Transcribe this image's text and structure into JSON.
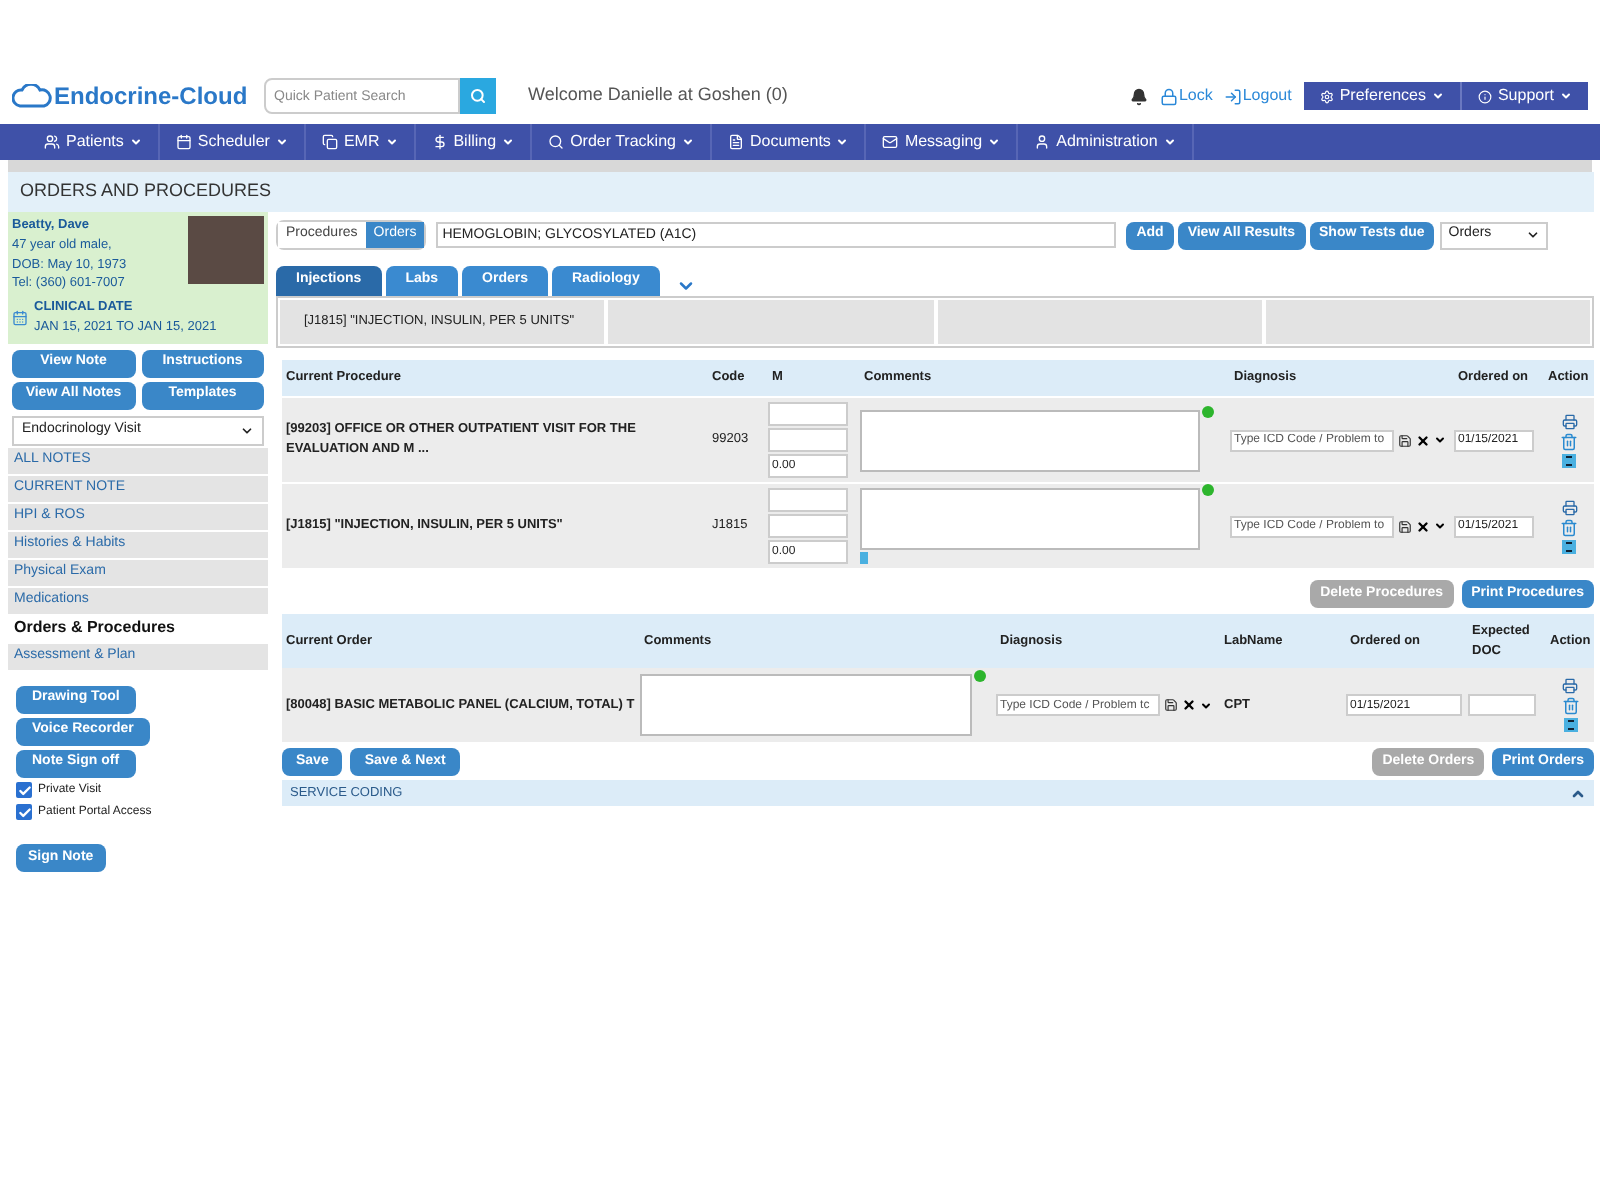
{
  "header": {
    "logo": "Endocrine-Cloud",
    "search_placeholder": "Quick Patient Search",
    "welcome": "Welcome Danielle at Goshen (0)",
    "lock": "Lock",
    "logout": "Logout",
    "menus": [
      "Preferences",
      "Support"
    ]
  },
  "nav": [
    "Patients",
    "Scheduler",
    "EMR",
    "Billing",
    "Order Tracking",
    "Documents",
    "Messaging",
    "Administration"
  ],
  "page_title": "ORDERS AND PROCEDURES",
  "patient": {
    "name": "Beatty, Dave",
    "details": [
      "47 year old male,",
      "DOB: May 10, 1973",
      "Tel: (360) 601-7007"
    ],
    "clinical_date_label": "CLINICAL DATE",
    "clinical_date": "JAN 15, 2021 TO JAN 15, 2021"
  },
  "note_buttons": [
    "View Note",
    "Instructions",
    "View All Notes",
    "Templates"
  ],
  "visit_select": "Endocrinology Visit",
  "sections": [
    {
      "label": "ALL NOTES",
      "selected": false
    },
    {
      "label": "CURRENT NOTE",
      "selected": false
    },
    {
      "label": "HPI & ROS",
      "selected": false
    },
    {
      "label": "Histories & Habits",
      "selected": false
    },
    {
      "label": "Physical Exam",
      "selected": false
    },
    {
      "label": "Medications",
      "selected": false
    },
    {
      "label": "Orders & Procedures",
      "selected": true
    },
    {
      "label": "Assessment & Plan",
      "selected": false
    }
  ],
  "tool_buttons": [
    "Drawing Tool",
    "Voice Recorder",
    "Note Sign off"
  ],
  "checkboxes": [
    {
      "label": "Private Visit",
      "checked": true
    },
    {
      "label": "Patient Portal Access",
      "checked": true
    }
  ],
  "sign_button": "Sign Note",
  "mode_toggle": [
    {
      "label": "Procedures",
      "selected": false
    },
    {
      "label": "Orders",
      "selected": true
    }
  ],
  "search_value": "HEMOGLOBIN; GLYCOSYLATED (A1C)",
  "action_buttons": [
    "Add",
    "View All Results",
    "Show Tests due"
  ],
  "filter_select": "Orders",
  "category_tabs": [
    {
      "label": "Injections",
      "selected": true
    },
    {
      "label": "Labs",
      "selected": false
    },
    {
      "label": "Orders",
      "selected": false
    },
    {
      "label": "Radiology",
      "selected": false
    }
  ],
  "quick_items": [
    "[J1815] \"INJECTION, INSULIN, PER 5 UNITS\""
  ],
  "procedures": {
    "columns": [
      "Current Procedure",
      "Code",
      "M",
      "Comments",
      "Diagnosis",
      "Ordered on",
      "Action"
    ],
    "rows": [
      {
        "procedure": "[99203] OFFICE OR OTHER OUTPATIENT VISIT FOR THE EVALUATION AND M ...",
        "code": "99203",
        "m_value": "0.00",
        "diagnosis_placeholder": "Type ICD Code / Problem to",
        "ordered_on": "01/15/2021"
      },
      {
        "procedure": "[J1815] \"INJECTION, INSULIN, PER 5 UNITS\"",
        "code": "J1815",
        "m_value": "0.00",
        "diagnosis_placeholder": "Type ICD Code / Problem to",
        "ordered_on": "01/15/2021"
      }
    ],
    "buttons": [
      {
        "label": "Delete Procedures",
        "disabled": true
      },
      {
        "label": "Print Procedures",
        "disabled": false
      }
    ]
  },
  "orders": {
    "columns": [
      "Current Order",
      "Comments",
      "Diagnosis",
      "LabName",
      "Ordered on",
      "Expected DOC",
      "Action"
    ],
    "rows": [
      {
        "order": "[80048] BASIC METABOLIC PANEL (CALCIUM, TOTAL) T",
        "diagnosis_placeholder": "Type ICD Code / Problem tc",
        "lab_name": "CPT",
        "ordered_on": "01/15/2021"
      }
    ],
    "left_buttons": [
      "Save",
      "Save & Next"
    ],
    "buttons": [
      {
        "label": "Delete Orders",
        "disabled": true
      },
      {
        "label": "Print Orders",
        "disabled": false
      }
    ]
  },
  "service_coding": {
    "label": "SERVICE CODING",
    "expanded": true
  }
}
